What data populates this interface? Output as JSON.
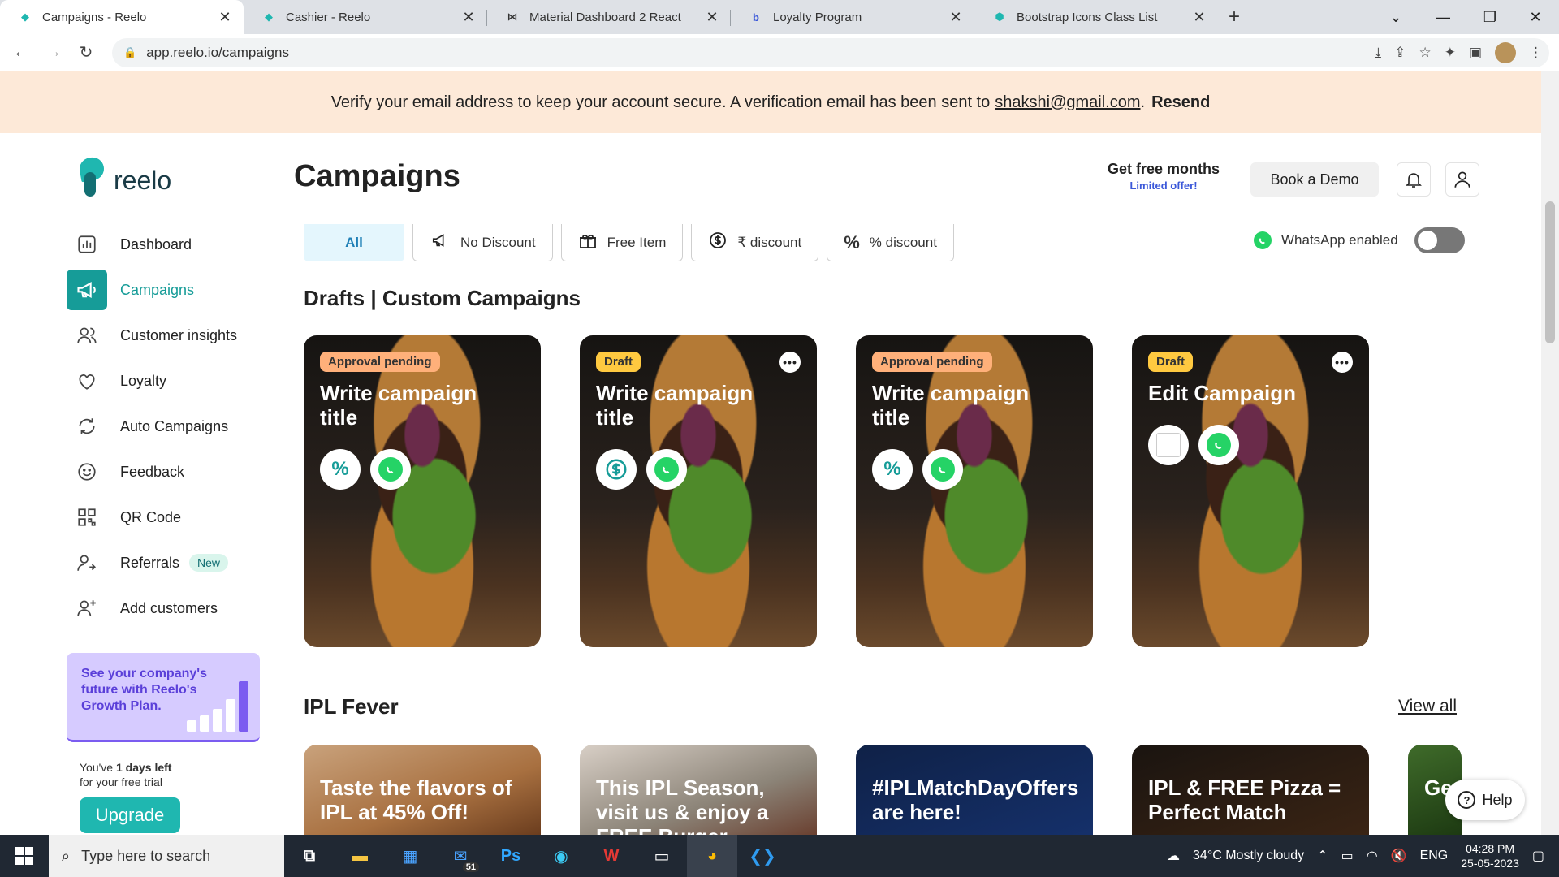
{
  "browser": {
    "tabs": [
      {
        "title": "Campaigns - Reelo",
        "active": true
      },
      {
        "title": "Cashier - Reelo",
        "active": false
      },
      {
        "title": "Material Dashboard 2 React",
        "active": false
      },
      {
        "title": "Loyalty Program",
        "active": false
      },
      {
        "title": "Bootstrap Icons Class List",
        "active": false
      }
    ],
    "url": "app.reelo.io/campaigns"
  },
  "banner": {
    "text": "Verify your email address to keep your account secure. A verification email has been sent to",
    "email": "shakshi@gmail.com",
    "period": ".",
    "resend": "Resend"
  },
  "sidebar": {
    "logo_text": "reelo",
    "items": [
      {
        "label": "Dashboard",
        "icon": "chart-icon"
      },
      {
        "label": "Campaigns",
        "icon": "megaphone-icon",
        "active": true
      },
      {
        "label": "Customer insights",
        "icon": "users-icon"
      },
      {
        "label": "Loyalty",
        "icon": "loyalty-icon"
      },
      {
        "label": "Auto Campaigns",
        "icon": "refresh-icon"
      },
      {
        "label": "Feedback",
        "icon": "smiley-icon"
      },
      {
        "label": "QR Code",
        "icon": "qr-icon"
      },
      {
        "label": "Referrals",
        "icon": "referral-icon",
        "badge": "New"
      },
      {
        "label": "Add customers",
        "icon": "add-user-icon"
      }
    ],
    "promo": "See your company's future with Reelo's Growth Plan.",
    "trial_prefix": "You've",
    "trial_days": "1 days left",
    "trial_suffix": "for your free trial",
    "upgrade": "Upgrade"
  },
  "header": {
    "title": "Campaigns",
    "free_months": "Get free months",
    "limited": "Limited offer!",
    "demo": "Book a Demo"
  },
  "filters": {
    "all": "All",
    "no_discount": "No Discount",
    "free_item": "Free Item",
    "rupee_discount": "₹ discount",
    "percent_discount": "% discount",
    "whatsapp": "WhatsApp enabled"
  },
  "drafts": {
    "title": "Drafts | Custom Campaigns",
    "cards": [
      {
        "badge": "Approval pending",
        "title": "Write campaign title",
        "icon": "percent-icon",
        "menu": false
      },
      {
        "badge": "Draft",
        "title": "Write campaign title",
        "icon": "dollar-icon",
        "menu": true
      },
      {
        "badge": "Approval pending",
        "title": "Write campaign title",
        "icon": "percent-icon",
        "menu": false
      },
      {
        "badge": "Draft",
        "title": "Edit Campaign",
        "icon": "blank-icon",
        "menu": true
      }
    ]
  },
  "ipl": {
    "title": "IPL Fever",
    "view_all": "View all",
    "cards": [
      "Taste the flavors of IPL at 45% Off!",
      "This IPL Season, visit us & enjoy a FREE Burger",
      "#IPLMatchDayOffers are here!",
      "IPL & FREE Pizza = Perfect Match",
      "Ge wi Be"
    ]
  },
  "help": "Help",
  "taskbar": {
    "search": "Type here to search",
    "weather": "34°C  Mostly cloudy",
    "lang": "ENG",
    "time": "04:28 PM",
    "date": "25-05-2023",
    "mail_count": "51"
  },
  "colors": {
    "accent": "#169c98",
    "banner": "#fde9d8",
    "pending": "#ffb07a",
    "draft": "#ffc940"
  }
}
